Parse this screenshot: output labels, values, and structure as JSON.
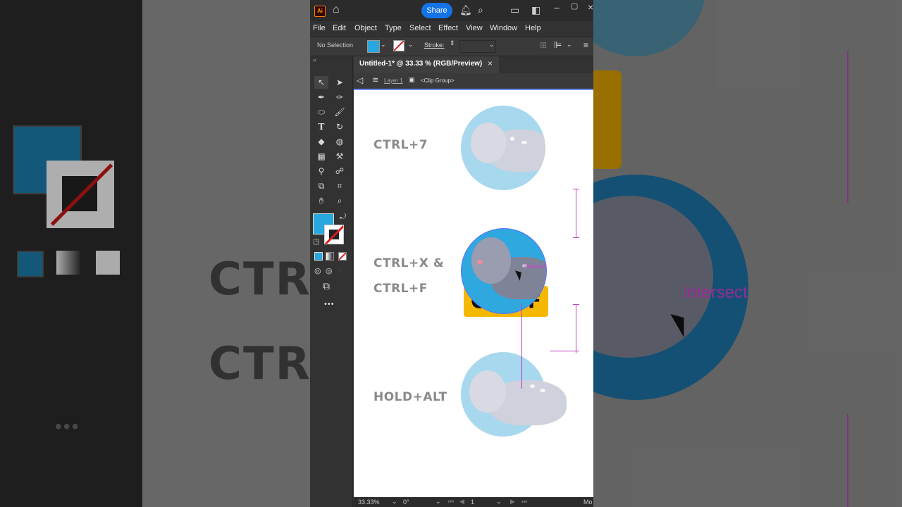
{
  "background": {
    "left_text": [
      "CTRL",
      "CTRL"
    ],
    "right_smart_guide_label": "intersect"
  },
  "titlebar": {
    "app_logo": "Ai",
    "share_label": "Share",
    "icons": [
      "home-icon",
      "bell-icon",
      "search-icon",
      "layout-icon",
      "panel-icon",
      "minimize-icon",
      "maximize-icon",
      "close-icon"
    ]
  },
  "menu": {
    "items": [
      "File",
      "Edit",
      "Object",
      "Type",
      "Select",
      "Effect",
      "View",
      "Window",
      "Help"
    ]
  },
  "control": {
    "selection_text": "No Selection",
    "stroke_label": "Stroke:",
    "fill_color": "#29a8e0",
    "stroke_color": "#d81e1e"
  },
  "document": {
    "tab_title": "Untitled-1* @ 33.33 % (RGB/Preview)",
    "breadcrumb_layer": "Layer 1",
    "breadcrumb_group": "<Clip Group>"
  },
  "artboard": {
    "labels": {
      "ctrl7": "CTRL+7",
      "ctrlx": "CTRL+X &",
      "ctrlf": "CTRL+F",
      "holdalt": "HOLD+ALT"
    },
    "badge": "Ctrl+F",
    "smart_guide_label": "intersect",
    "circle_colors": [
      "#a7d8ee",
      "#2fa8df",
      "#a7d8ee"
    ]
  },
  "status": {
    "zoom": "33.33%",
    "rotation": "0°",
    "artboard_number": "1",
    "mode": "Mo"
  },
  "toolbar": {
    "more_label": "•••",
    "fill_swatch_color": "#29a8e0"
  }
}
